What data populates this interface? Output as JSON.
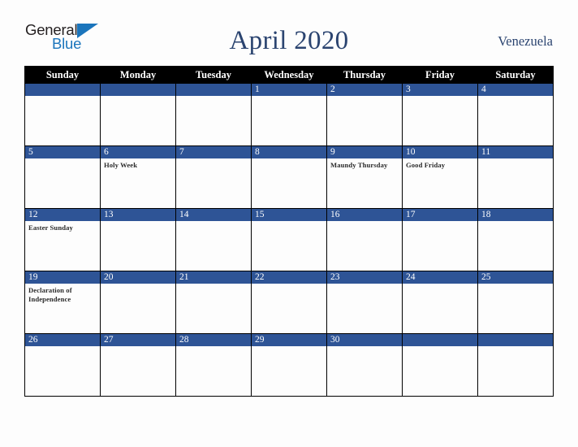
{
  "brand": {
    "name_part1": "General",
    "name_part2": "Blue",
    "triangle_color": "#1b75bc",
    "text_color": "#231f20"
  },
  "header": {
    "title": "April 2020",
    "locale": "Venezuela",
    "title_color": "#2b4470"
  },
  "theme": {
    "header_row_bg": "#000000",
    "header_row_text": "#ffffff",
    "date_bar_bg": "#2e5496",
    "date_bar_text": "#ffffff",
    "cell_bg": "#fdfdfd",
    "grid_line": "#000000",
    "event_text": "#2b2b2b"
  },
  "calendar": {
    "month": "April",
    "year": "2020",
    "weekday_headers": [
      "Sunday",
      "Monday",
      "Tuesday",
      "Wednesday",
      "Thursday",
      "Friday",
      "Saturday"
    ],
    "weeks": [
      [
        {
          "day": "",
          "events": []
        },
        {
          "day": "",
          "events": []
        },
        {
          "day": "",
          "events": []
        },
        {
          "day": "1",
          "events": []
        },
        {
          "day": "2",
          "events": []
        },
        {
          "day": "3",
          "events": []
        },
        {
          "day": "4",
          "events": []
        }
      ],
      [
        {
          "day": "5",
          "events": []
        },
        {
          "day": "6",
          "events": [
            "Holy Week"
          ]
        },
        {
          "day": "7",
          "events": []
        },
        {
          "day": "8",
          "events": []
        },
        {
          "day": "9",
          "events": [
            "Maundy Thursday"
          ]
        },
        {
          "day": "10",
          "events": [
            "Good Friday"
          ]
        },
        {
          "day": "11",
          "events": []
        }
      ],
      [
        {
          "day": "12",
          "events": [
            "Easter Sunday"
          ]
        },
        {
          "day": "13",
          "events": []
        },
        {
          "day": "14",
          "events": []
        },
        {
          "day": "15",
          "events": []
        },
        {
          "day": "16",
          "events": []
        },
        {
          "day": "17",
          "events": []
        },
        {
          "day": "18",
          "events": []
        }
      ],
      [
        {
          "day": "19",
          "events": [
            "Declaration of Independence"
          ]
        },
        {
          "day": "20",
          "events": []
        },
        {
          "day": "21",
          "events": []
        },
        {
          "day": "22",
          "events": []
        },
        {
          "day": "23",
          "events": []
        },
        {
          "day": "24",
          "events": []
        },
        {
          "day": "25",
          "events": []
        }
      ],
      [
        {
          "day": "26",
          "events": []
        },
        {
          "day": "27",
          "events": []
        },
        {
          "day": "28",
          "events": []
        },
        {
          "day": "29",
          "events": []
        },
        {
          "day": "30",
          "events": []
        },
        {
          "day": "",
          "events": []
        },
        {
          "day": "",
          "events": []
        }
      ]
    ]
  }
}
